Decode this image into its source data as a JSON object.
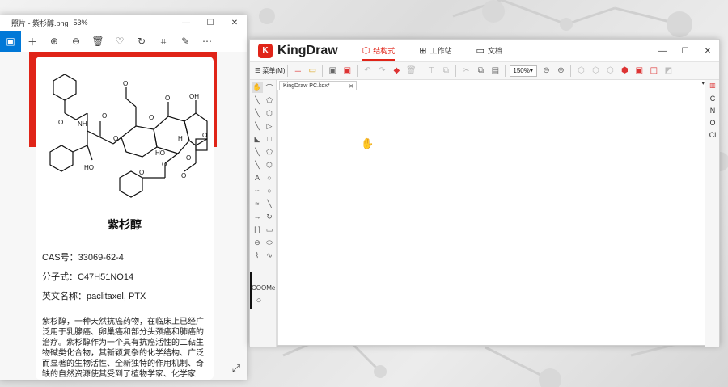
{
  "photos": {
    "title": "照片 - 紫杉醇.png",
    "zoom": "53%",
    "compound": {
      "name": "紫杉醇",
      "cas": "CAS号：33069-62-4",
      "formula": "分子式：C47H51NO14",
      "english": "英文名称：paclitaxel, PTX",
      "description": "紫杉醇，一种天然抗癌药物，在临床上已经广泛用于乳腺癌、卵巢癌和部分头颈癌和肺癌的治疗。紫杉醇作为一个具有抗癌活性的二萜生物碱类化合物，其新颖复杂的化学结构、广泛而显著的生物活性、全新独特的作用机制、奇缺的自然资源使其受到了植物学家、化学家"
    },
    "structure_labels": [
      "O",
      "NH",
      "O",
      "O",
      "HO",
      "O",
      "O",
      "OH",
      "O",
      "H",
      "O",
      "HO",
      "O",
      "O",
      "O",
      "O"
    ]
  },
  "kingdraw": {
    "brand": "KingDraw",
    "logo_glyph": "K",
    "tabs": [
      {
        "label": "结构式",
        "icon": "hexagon-icon",
        "glyph": "⬡"
      },
      {
        "label": "工作站",
        "icon": "grid-icon",
        "glyph": "⊞"
      },
      {
        "label": "文档",
        "icon": "folder-icon",
        "glyph": "▭"
      }
    ],
    "menu_label": "菜单(M)",
    "zoom": "150%",
    "document_tab": "KingDraw PC.kdx*",
    "coome_label": "COOMe",
    "elements": [
      "C",
      "N",
      "O",
      "Cl"
    ]
  },
  "colors": {
    "accent": "#e02418",
    "windows_blue": "#0078d7"
  }
}
